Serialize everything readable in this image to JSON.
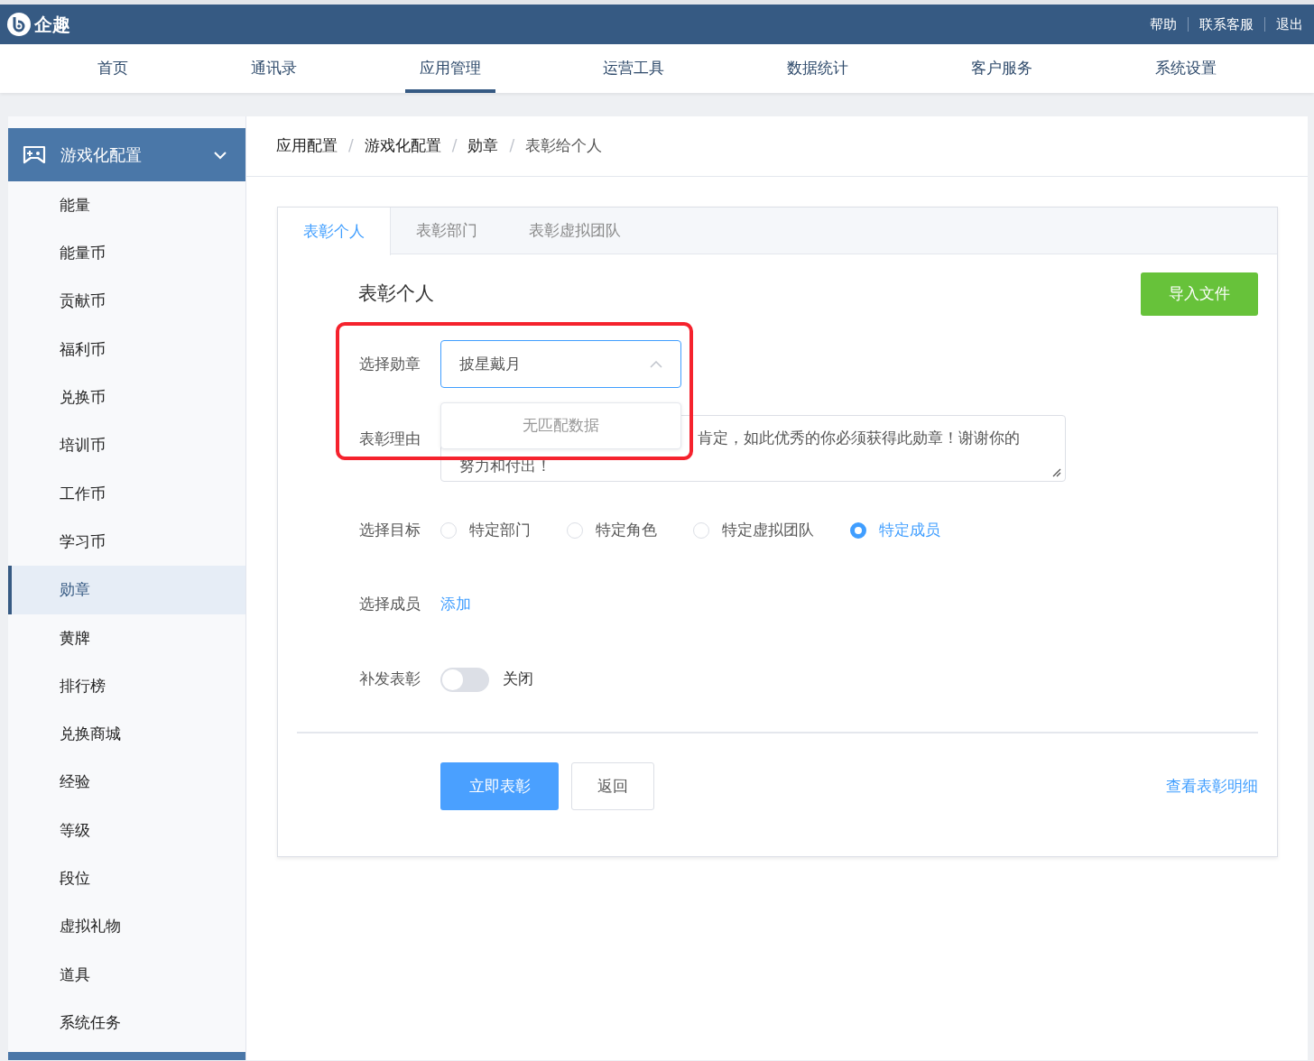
{
  "header": {
    "brand": "企趣",
    "links": [
      "帮助",
      "联系客服",
      "退出"
    ]
  },
  "nav": [
    {
      "label": "首页",
      "selected": false
    },
    {
      "label": "通讯录",
      "selected": false
    },
    {
      "label": "应用管理",
      "selected": true
    },
    {
      "label": "运营工具",
      "selected": false
    },
    {
      "label": "数据统计",
      "selected": false
    },
    {
      "label": "客户服务",
      "selected": false
    },
    {
      "label": "系统设置",
      "selected": false
    }
  ],
  "sidebar": {
    "group": {
      "label": "游戏化配置",
      "expanded": true
    },
    "items": [
      {
        "label": "能量",
        "selected": false
      },
      {
        "label": "能量币",
        "selected": false
      },
      {
        "label": "贡献币",
        "selected": false
      },
      {
        "label": "福利币",
        "selected": false
      },
      {
        "label": "兑换币",
        "selected": false
      },
      {
        "label": "培训币",
        "selected": false
      },
      {
        "label": "工作币",
        "selected": false
      },
      {
        "label": "学习币",
        "selected": false
      },
      {
        "label": "勋章",
        "selected": true
      },
      {
        "label": "黄牌",
        "selected": false
      },
      {
        "label": "排行榜",
        "selected": false
      },
      {
        "label": "兑换商城",
        "selected": false
      },
      {
        "label": "经验",
        "selected": false
      },
      {
        "label": "等级",
        "selected": false
      },
      {
        "label": "段位",
        "selected": false
      },
      {
        "label": "虚拟礼物",
        "selected": false
      },
      {
        "label": "道具",
        "selected": false
      },
      {
        "label": "系统任务",
        "selected": false
      }
    ]
  },
  "breadcrumb": {
    "separator": "/",
    "items": [
      "应用配置",
      "游戏化配置",
      "勋章",
      "表彰给个人"
    ]
  },
  "tabs": [
    {
      "label": "表彰个人",
      "selected": true
    },
    {
      "label": "表彰部门",
      "selected": false
    },
    {
      "label": "表彰虚拟团队",
      "selected": false
    }
  ],
  "form": {
    "title": "表彰个人",
    "import_button": "导入文件",
    "badge": {
      "label": "选择勋章",
      "value": "披星戴月",
      "open": true,
      "empty_text": "无匹配数据",
      "highlighted": true
    },
    "reason": {
      "label": "表彰理由",
      "lines": [
        "肯定，如此优秀的你必须获得此勋章！谢谢你的",
        "努力和付出！"
      ]
    },
    "target": {
      "label": "选择目标",
      "options": [
        {
          "label": "特定部门",
          "selected": false
        },
        {
          "label": "特定角色",
          "selected": false
        },
        {
          "label": "特定虚拟团队",
          "selected": false
        },
        {
          "label": "特定成员",
          "selected": true
        }
      ]
    },
    "members": {
      "label": "选择成员",
      "link": "添加"
    },
    "reissue": {
      "label": "补发表彰",
      "on": false,
      "state_text": "关闭"
    },
    "buttons": {
      "submit": "立即表彰",
      "back": "返回"
    },
    "detail_link": "查看表彰明细"
  }
}
